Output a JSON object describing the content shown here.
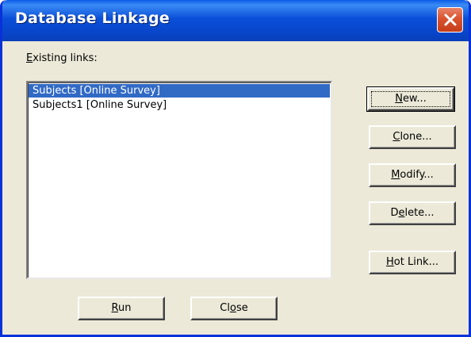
{
  "window": {
    "title": "Database Linkage"
  },
  "existing": {
    "label_first": "E",
    "label_rest": "xisting links:"
  },
  "links": [
    {
      "label": "Subjects [Online Survey]",
      "selected": true
    },
    {
      "label": "Subjects1 [Online Survey]",
      "selected": false
    }
  ],
  "buttons": {
    "new": {
      "accel": "N",
      "rest": "ew..."
    },
    "clone": {
      "accel": "C",
      "rest": "lone..."
    },
    "modify": {
      "accel": "M",
      "rest": "odify..."
    },
    "delete_pre": "D",
    "delete_accel": "e",
    "delete_rest": "lete...",
    "hotlink_accel": "H",
    "hotlink_rest": "ot Link...",
    "run": {
      "accel": "R",
      "rest": "un"
    },
    "close_pre": "Cl",
    "close_accel": "o",
    "close_rest": "se"
  },
  "colors": {
    "selection": "#316ac5",
    "titlebar": "#0a4fd8",
    "face": "#ece9d8",
    "close_button": "#d9532e"
  },
  "icons": {
    "close": "close-icon"
  }
}
